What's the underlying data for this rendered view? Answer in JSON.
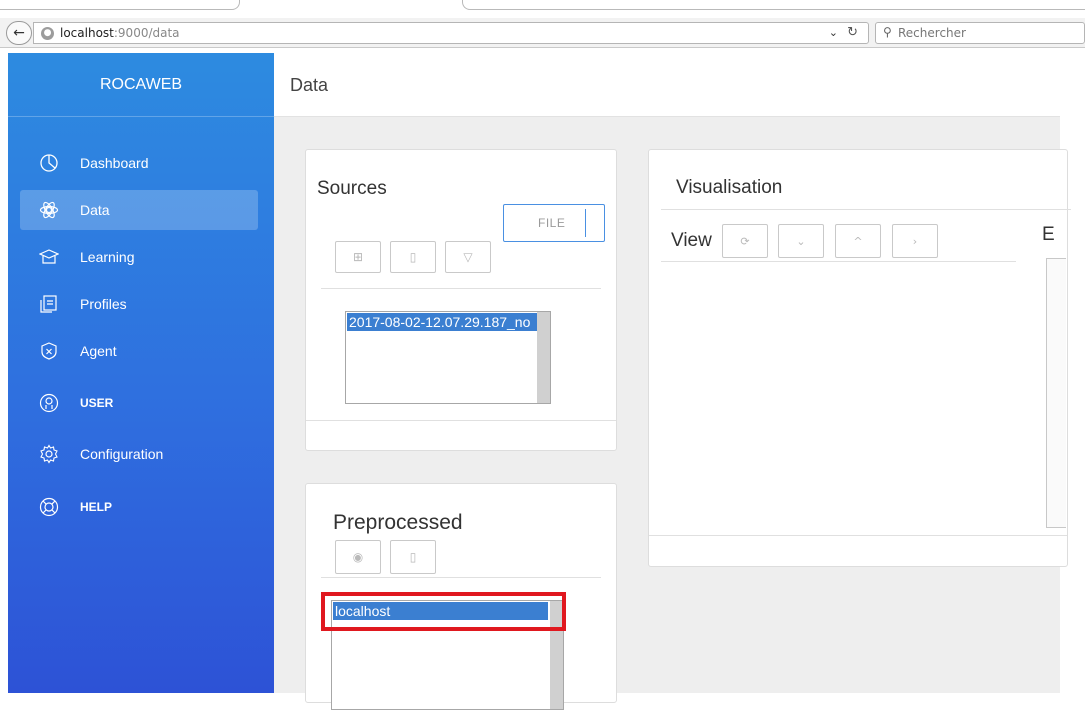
{
  "browser": {
    "url_host": "localhost",
    "url_rest": ":9000/data",
    "search_placeholder": "Rechercher"
  },
  "sidebar": {
    "brand": "ROCAWEB",
    "items": [
      {
        "label": "Dashboard",
        "icon": "pie-chart-icon"
      },
      {
        "label": "Data",
        "icon": "molecule-icon",
        "active": true
      },
      {
        "label": "Learning",
        "icon": "graduation-cap-icon"
      },
      {
        "label": "Profiles",
        "icon": "document-stack-icon"
      },
      {
        "label": "Agent",
        "icon": "shield-x-icon"
      },
      {
        "label": "USER",
        "icon": "user-circle-icon"
      },
      {
        "label": "Configuration",
        "icon": "gear-icon"
      },
      {
        "label": "HELP",
        "icon": "lifebuoy-icon"
      }
    ]
  },
  "header": {
    "title": "Data"
  },
  "sources": {
    "title": "Sources",
    "file_button": "FILE",
    "toolbar_icons": [
      "add-icon",
      "trash-icon",
      "filter-icon"
    ],
    "list": [
      "2017-08-02-12.07.29.187_no"
    ]
  },
  "preprocessed": {
    "title": "Preprocessed",
    "toolbar_icons": [
      "eye-icon",
      "trash-icon"
    ],
    "list": [
      "localhost"
    ]
  },
  "visualisation": {
    "title": "Visualisation",
    "view_label": "View",
    "right_label": "E",
    "view_buttons": [
      {
        "icon": "refresh-icon",
        "glyph": "⟳"
      },
      {
        "icon": "chevron-down-icon",
        "glyph": "⌄"
      },
      {
        "icon": "chevron-up-icon",
        "glyph": "^"
      },
      {
        "icon": "chevron-right-icon",
        "glyph": "›"
      }
    ]
  },
  "colors": {
    "sidebar_top": "#2d8be0",
    "sidebar_bottom": "#2d52d6",
    "selection": "#3b7fd1",
    "highlight": "#e0181f",
    "file_button_border": "#4a90e2"
  }
}
